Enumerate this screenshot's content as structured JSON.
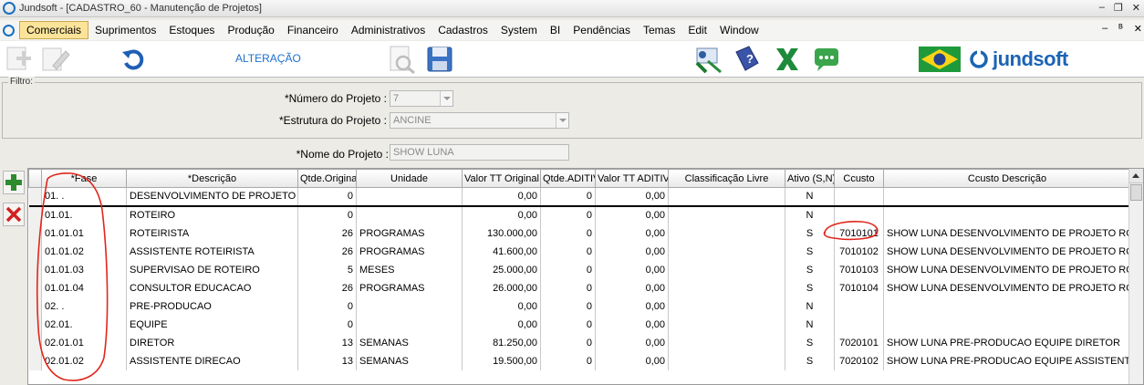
{
  "window": {
    "title": "Jundsoft - [CADASTRO_60 - Manutenção de Projetos]",
    "min": "–",
    "restore": "❐",
    "close": "✕"
  },
  "menu": {
    "items": [
      "Comerciais",
      "Suprimentos",
      "Estoques",
      "Produção",
      "Financeiro",
      "Administrativos",
      "Cadastros",
      "System",
      "BI",
      "Pendências",
      "Temas",
      "Edit",
      "Window"
    ],
    "active_index": 0,
    "mdi_min": "–",
    "mdi_restore": "ᴮ",
    "mdi_close": "✕"
  },
  "toolbar": {
    "mode_label": "ALTERAÇÃO",
    "brand": "jundsoft"
  },
  "filter": {
    "legend": "Filtro:",
    "numero_label": "*Número do Projeto :",
    "numero_value": "7",
    "estrutura_label": "*Estrutura do Projeto :",
    "estrutura_value": "ANCINE",
    "nome_label": "*Nome do Projeto :",
    "nome_value": "SHOW LUNA"
  },
  "grid": {
    "columns": [
      "*Fase",
      "*Descrição",
      "Qtde.Original",
      "Unidade",
      "Valor TT Original",
      "Qtde.ADITIVO",
      "Valor TT ADITIVO",
      "Classificação Livre",
      "Ativo (S,N)",
      "Ccusto",
      "Ccusto Descrição"
    ],
    "rows": [
      [
        "01.  .",
        "DESENVOLVIMENTO DE PROJETO",
        "0",
        "",
        "0,00",
        "0",
        "0,00",
        "",
        "N",
        "",
        ""
      ],
      [
        "01.01.",
        "ROTEIRO",
        "0",
        "",
        "0,00",
        "0",
        "0,00",
        "",
        "N",
        "",
        ""
      ],
      [
        "01.01.01",
        "ROTEIRISTA",
        "26",
        "PROGRAMAS",
        "130.000,00",
        "0",
        "0,00",
        "",
        "S",
        "7010101",
        "SHOW LUNA DESENVOLVIMENTO DE PROJETO ROTEIRO ROTEIRISTA"
      ],
      [
        "01.01.02",
        "ASSISTENTE ROTEIRISTA",
        "26",
        "PROGRAMAS",
        "41.600,00",
        "0",
        "0,00",
        "",
        "S",
        "7010102",
        "SHOW LUNA DESENVOLVIMENTO DE PROJETO ROTEIRO ASSISTENTE"
      ],
      [
        "01.01.03",
        "SUPERVISAO DE ROTEIRO",
        "5",
        "MESES",
        "25.000,00",
        "0",
        "0,00",
        "",
        "S",
        "7010103",
        "SHOW LUNA DESENVOLVIMENTO DE PROJETO ROTEIRO SUPERVISAO"
      ],
      [
        "01.01.04",
        "CONSULTOR EDUCACAO",
        "26",
        "PROGRAMAS",
        "26.000,00",
        "0",
        "0,00",
        "",
        "S",
        "7010104",
        "SHOW LUNA DESENVOLVIMENTO DE PROJETO ROTEIRO CONSULTOR"
      ],
      [
        "02.  .",
        "PRE-PRODUCAO",
        "0",
        "",
        "0,00",
        "0",
        "0,00",
        "",
        "N",
        "",
        ""
      ],
      [
        "02.01.",
        "EQUIPE",
        "0",
        "",
        "0,00",
        "0",
        "0,00",
        "",
        "N",
        "",
        ""
      ],
      [
        "02.01.01",
        "DIRETOR",
        "13",
        "SEMANAS",
        "81.250,00",
        "0",
        "0,00",
        "",
        "S",
        "7020101",
        "SHOW LUNA PRE-PRODUCAO EQUIPE DIRETOR"
      ],
      [
        "02.01.02",
        "ASSISTENTE DIRECAO",
        "13",
        "SEMANAS",
        "19.500,00",
        "0",
        "0,00",
        "",
        "S",
        "7020102",
        "SHOW LUNA PRE-PRODUCAO EQUIPE ASSISTENTE DIRECAO"
      ]
    ]
  },
  "colors": {
    "accent": "#1f6fcf",
    "menu_active": "#fbe39a",
    "annotation": "#e0261b"
  },
  "icons": [
    "new-icon",
    "edit-icon",
    "undo-icon",
    "search-doc-icon",
    "save-icon",
    "presentation-icon",
    "help-book-icon",
    "excel-icon",
    "chat-icon",
    "brazil-flag-icon",
    "add-row-icon",
    "delete-row-icon"
  ]
}
